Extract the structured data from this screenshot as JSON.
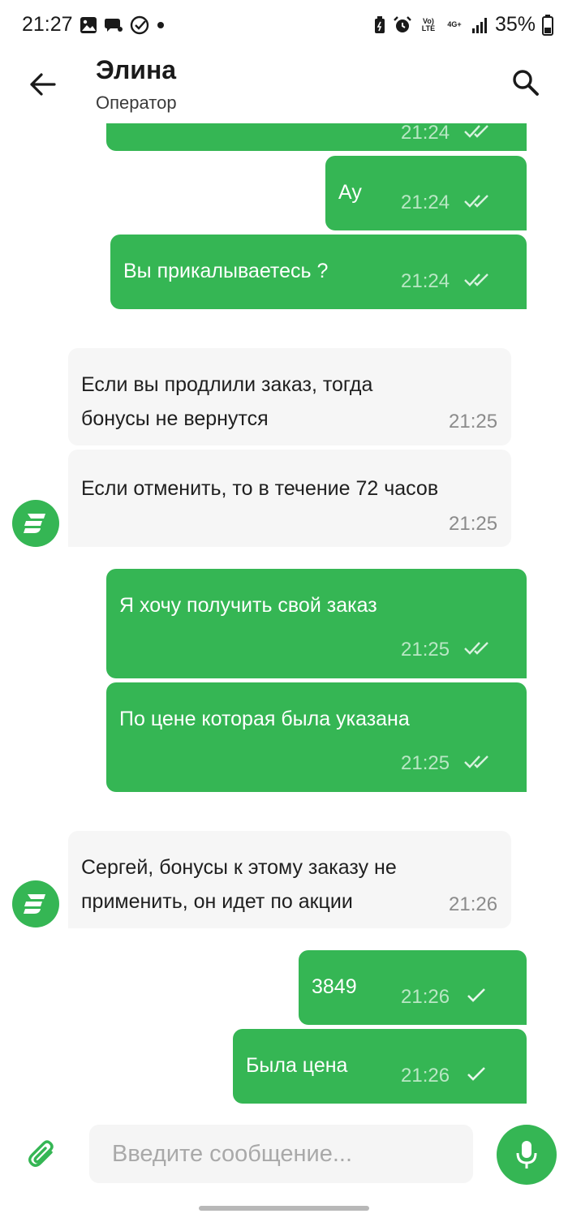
{
  "status_bar": {
    "time": "21:27",
    "volte_label": "Vo) LTE",
    "network_label": "4G+",
    "battery": "35%"
  },
  "header": {
    "title": "Элина",
    "subtitle": "Оператор"
  },
  "messages": [
    {
      "direction": "out",
      "text": "",
      "time": "21:24",
      "status": "read"
    },
    {
      "direction": "out",
      "text": "Ау",
      "time": "21:24",
      "status": "read"
    },
    {
      "direction": "out",
      "text": "Вы прикалываетесь ?",
      "time": "21:24",
      "status": "read"
    },
    {
      "direction": "in",
      "text": "Если вы продлили заказ, тогда бонусы не вернутся",
      "time": "21:25"
    },
    {
      "direction": "in",
      "text": "Если отменить, то в течение 72 часов",
      "time": "21:25"
    },
    {
      "direction": "out",
      "text": "Я хочу получить свой заказ",
      "time": "21:25",
      "status": "read"
    },
    {
      "direction": "out",
      "text": "По цене которая была указана",
      "time": "21:25",
      "status": "read"
    },
    {
      "direction": "in",
      "text": "Сергей, бонусы к этому заказу не применить, он идет по акции",
      "time": "21:26"
    },
    {
      "direction": "out",
      "text": "3849",
      "time": "21:26",
      "status": "sent"
    },
    {
      "direction": "out",
      "text": "Была цена",
      "time": "21:26",
      "status": "sent"
    }
  ],
  "composer": {
    "placeholder": "Введите сообщение..."
  },
  "colors": {
    "accent": "#35b654",
    "incoming_bubble": "#f6f6f6",
    "outgoing_time": "#b9e7c4"
  },
  "icons": {
    "back": "arrow-left-icon",
    "search": "search-icon",
    "attach": "paperclip-icon",
    "mic": "microphone-icon",
    "avatar": "brand-logo-icon",
    "read": "double-check-icon",
    "sent": "single-check-icon"
  }
}
